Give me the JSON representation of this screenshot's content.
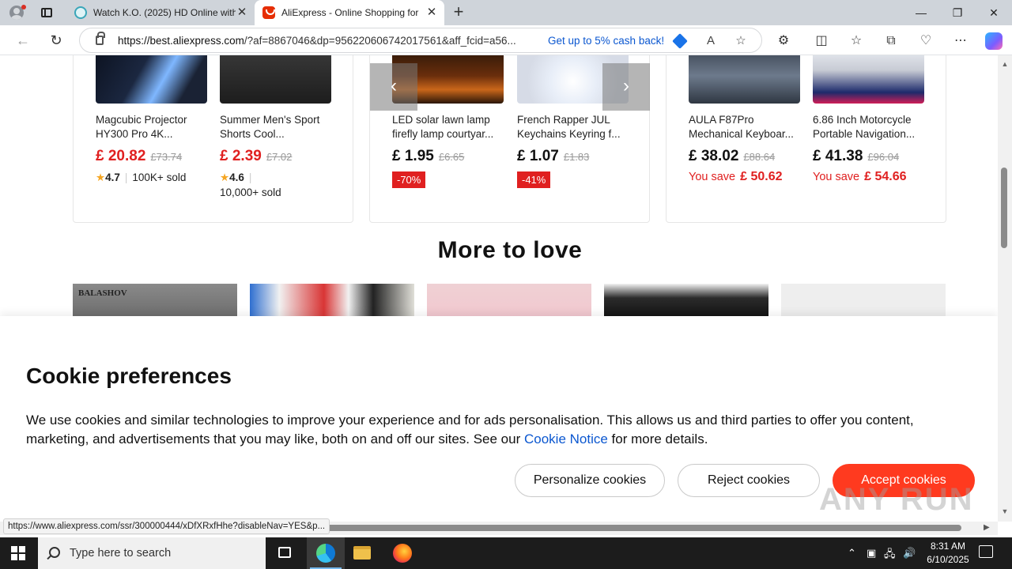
{
  "browser": {
    "tabs": [
      {
        "title": "Watch K.O. (2025) HD Online with"
      },
      {
        "title": "AliExpress - Online Shopping for"
      }
    ],
    "address": {
      "host": "https://best.aliexpress.com",
      "path": "/?af=8867046&dp=956220606742017561&aff_fcid=a56...",
      "promo": "Get up to 5% cash back!"
    }
  },
  "products_left": [
    {
      "name": "Magcubic Projector HY300 Pro 4K...",
      "currency": "£",
      "price": "20.82",
      "old": "£73.74",
      "rating": "4.7",
      "sold": "100K+ sold"
    },
    {
      "name": "Summer Men's Sport Shorts Cool...",
      "currency": "£",
      "price": "2.39",
      "old": "£7.02",
      "rating": "4.6",
      "sold": "10,000+ sold"
    }
  ],
  "products_mid": [
    {
      "name": "LED solar lawn lamp firefly lamp courtyar...",
      "currency": "£",
      "price": "1.95",
      "old": "£6.65",
      "discount": "-70%"
    },
    {
      "name": "French Rapper JUL Keychains Keyring f...",
      "currency": "£",
      "price": "1.07",
      "old": "£1.83",
      "discount": "-41%"
    }
  ],
  "products_right": [
    {
      "name": "AULA F87Pro Mechanical Keyboar...",
      "currency": "£",
      "price": "38.02",
      "old": "£88.64",
      "save_label": "You save",
      "save_currency": "£",
      "save_amount": "50.62"
    },
    {
      "name": "6.86 Inch Motorcycle Portable Navigation...",
      "currency": "£",
      "price": "41.38",
      "old": "£96.04",
      "save_label": "You save",
      "save_currency": "£",
      "save_amount": "54.66"
    }
  ],
  "section": {
    "title": "More to love",
    "tile1_brand": "BALASHOV"
  },
  "cookie": {
    "title": "Cookie preferences",
    "body": "We use cookies and similar technologies to improve your experience and for ads personalisation. This allows us and third parties to offer you content, marketing, and advertisements that you may like, both on and off our sites. See our ",
    "link": "Cookie Notice",
    "body_end": " for more details.",
    "personalize": "Personalize cookies",
    "reject": "Reject cookies",
    "accept": "Accept cookies"
  },
  "status_url": "https://www.aliexpress.com/ssr/300000444/xDfXRxfHhe?disableNav=YES&p...",
  "watermark": "ANY RUN",
  "taskbar": {
    "search_placeholder": "Type here to search",
    "time": "8:31 AM",
    "date": "6/10/2025"
  },
  "colors": {
    "ali_red": "#e02020",
    "accept": "#ff3a1f",
    "link": "#0b57d0"
  }
}
